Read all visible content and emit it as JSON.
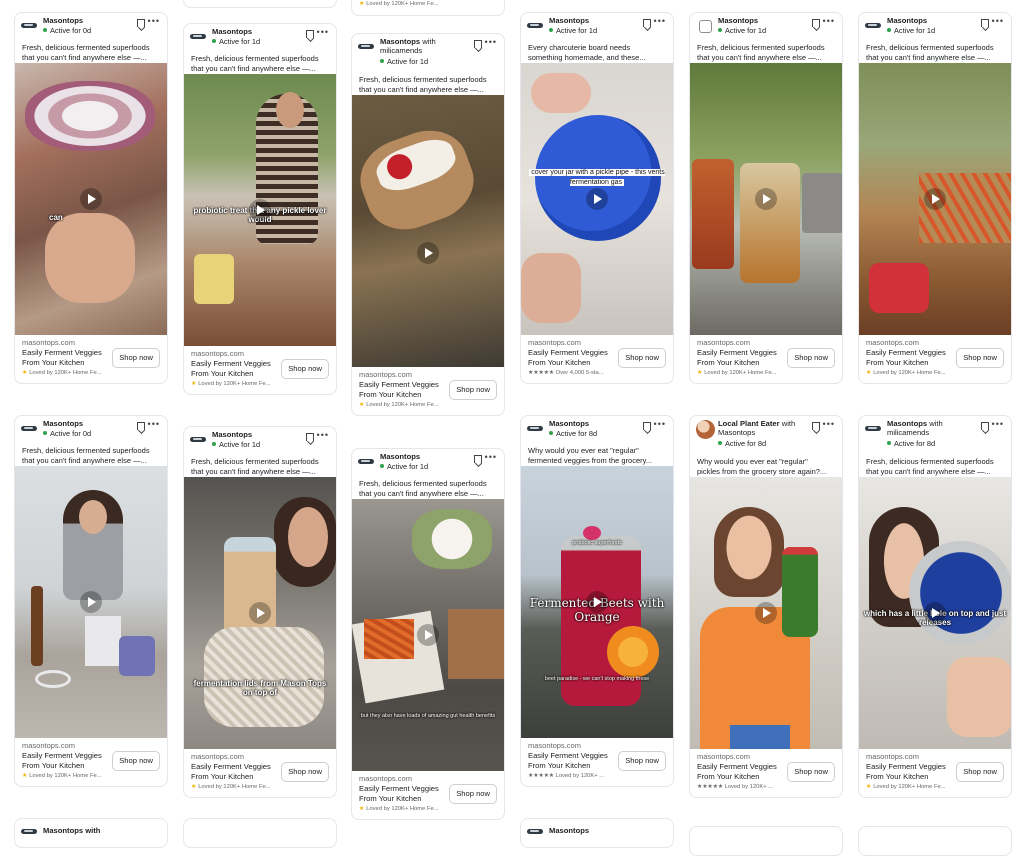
{
  "cards": [
    {
      "advertiser": "Masontops",
      "partner": "",
      "status": "Active for 0d",
      "text1": "Fresh, delicious fermented superfoods",
      "text2": "that you can't find anywhere else —...",
      "domain": "masontops.com",
      "headline1": "Easily Ferment Veggies",
      "headline2": "From Your Kitchen",
      "rating": "Loved by 120K+ Home Fe...",
      "cta": "Shop now",
      "overlay": "can",
      "icon": "masontops-logo-icon"
    },
    {
      "advertiser": "Masontops",
      "partner": "",
      "status": "Active for 1d",
      "text1": "Fresh, delicious fermented superfoods",
      "text2": "that you can't find anywhere else —...",
      "domain": "masontops.com",
      "headline1": "Easily Ferment Veggies",
      "headline2": "From Your Kitchen",
      "rating": "Loved by 120K+ Home Fe...",
      "cta": "Shop now",
      "overlay": "probiotic treat that any pickle lover would",
      "icon": "masontops-logo-icon"
    },
    {
      "advertiser": "Masontops",
      "partner": "with milicamends",
      "status": "Active for 1d",
      "text1": "Fresh, delicious fermented superfoods",
      "text2": "that you can't find anywhere else —...",
      "domain": "masontops.com",
      "headline1": "Easily Ferment Veggies",
      "headline2": "From Your Kitchen",
      "rating": "Loved by 120K+ Home Fe...",
      "cta": "Shop now",
      "overlay": "",
      "icon": "masontops-logo-icon"
    },
    {
      "advertiser": "Masontops",
      "partner": "",
      "status": "Active for 1d",
      "text1": "Every charcuterie board needs",
      "text2": "something homemade, and these...",
      "domain": "masontops.com",
      "headline1": "Easily Ferment Veggies",
      "headline2": "From Your Kitchen",
      "rating": "★★★★★ Over 4,000 5-sta...",
      "cta": "Shop now",
      "overlay": "cover your jar with a pickle pipe - this vents fermentation gas",
      "icon": "masontops-logo-icon"
    },
    {
      "advertiser": "Masontops",
      "partner": "",
      "status": "Active for 1d",
      "text1": "Fresh, delicious fermented superfoods",
      "text2": "that you can't find anywhere else —...",
      "domain": "masontops.com",
      "headline1": "Easily Ferment Veggies",
      "headline2": "From Your Kitchen",
      "rating": "Loved by 120K+ Home Fe...",
      "cta": "Shop now",
      "overlay": "",
      "icon": "checkbox-icon"
    },
    {
      "advertiser": "Masontops",
      "partner": "",
      "status": "Active for 1d",
      "text1": "Fresh, delicious fermented superfoods",
      "text2": "that you can't find anywhere else —...",
      "domain": "masontops.com",
      "headline1": "Easily Ferment Veggies",
      "headline2": "From Your Kitchen",
      "rating": "Loved by 120K+ Home Fe...",
      "cta": "Shop now",
      "overlay": "",
      "icon": "masontops-logo-icon"
    },
    {
      "advertiser": "Masontops",
      "partner": "",
      "status": "Active for 0d",
      "text1": "Fresh, delicious fermented superfoods",
      "text2": "that you can't find anywhere else —...",
      "domain": "masontops.com",
      "headline1": "Easily Ferment Veggies",
      "headline2": "From Your Kitchen",
      "rating": "Loved by 120K+ Home Fe...",
      "cta": "Shop now",
      "overlay": "",
      "icon": "masontops-logo-icon"
    },
    {
      "advertiser": "Masontops",
      "partner": "",
      "status": "Active for 1d",
      "text1": "Fresh, delicious fermented superfoods",
      "text2": "that you can't find anywhere else —...",
      "domain": "masontops.com",
      "headline1": "Easily Ferment Veggies",
      "headline2": "From Your Kitchen",
      "rating": "Loved by 120K+ Home Fe...",
      "cta": "Shop now",
      "overlay": "fermentation lids from Mason Tops on top of",
      "icon": "masontops-logo-icon"
    },
    {
      "advertiser": "Masontops",
      "partner": "",
      "status": "Active for 1d",
      "text1": "Fresh, delicious fermented superfoods",
      "text2": "that you can't find anywhere else —...",
      "domain": "masontops.com",
      "headline1": "Easily Ferment Veggies",
      "headline2": "From Your Kitchen",
      "rating": "Loved by 120K+ Home Fe...",
      "cta": "Shop now",
      "overlay": "but they also have loads of amazing gut health benefits",
      "icon": "masontops-logo-icon"
    },
    {
      "advertiser": "Masontops",
      "partner": "",
      "status": "Active for 8d",
      "text1": "Why would you ever eat \"regular\"",
      "text2": "fermented veggies from the grocery...",
      "domain": "masontops.com",
      "headline1": "Easily Ferment Veggies",
      "headline2": "From Your Kitchen",
      "rating": "★★★★★ Loved by 120K+ ...",
      "cta": "Shop now",
      "overlay": "Fermented Beets with Orange",
      "overlay_top": "probiotic superfoods",
      "overlay_bottom": "beet paradise - we can't stop making these",
      "icon": "masontops-logo-icon"
    },
    {
      "advertiser": "Local Plant Eater",
      "partner": "with Masontops",
      "status": "Active for 8d",
      "text1": "Why would you ever eat \"regular\"",
      "text2": "pickles from the grocery store again?...",
      "domain": "masontops.com",
      "headline1": "Easily Ferment Veggies",
      "headline2": "From Your Kitchen",
      "rating": "★★★★★ Loved by 120K+ ...",
      "cta": "Shop now",
      "overlay": "",
      "icon": "avatar-icon"
    },
    {
      "advertiser": "Masontops",
      "partner": "with milicamends",
      "status": "Active for 8d",
      "text1": "Fresh, delicious fermented superfoods",
      "text2": "that you can't find anywhere else —...",
      "domain": "masontops.com",
      "headline1": "Easily Ferment Veggies",
      "headline2": "From Your Kitchen",
      "rating": "Loved by 120K+ Home Fe...",
      "cta": "Shop now",
      "overlay": "which has a little hole on top and just releases",
      "icon": "masontops-logo-icon"
    }
  ],
  "top_partial": {
    "rating": "Loved by 120K+ Home Fe..."
  },
  "bottom_partial": [
    {
      "advertiser": "Masontops with"
    },
    {
      "advertiser": "Masontops"
    }
  ],
  "colors": {
    "active_dot": "#31a24c",
    "border": "#e4e6eb",
    "muted_text": "#65676b"
  }
}
